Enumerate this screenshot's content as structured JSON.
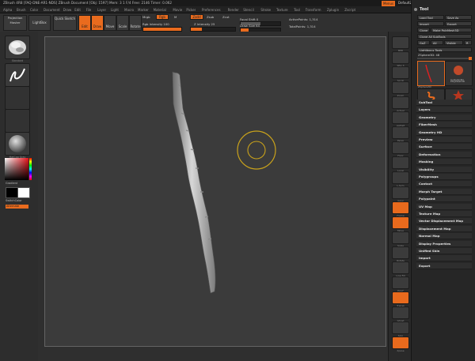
{
  "title_bar": {
    "text": "ZBrush 4R8 [FAQ-DNE-AR1-NDS] ZBrush Document [Obj: 1597] Mem: 3 1 F/4 Free: 2146 Timer: 0.062",
    "menu_label": "Menus",
    "default_script": "DefaultZScript"
  },
  "menu": [
    "Alpha",
    "Brush",
    "Color",
    "Document",
    "Draw",
    "Edit",
    "File",
    "Layer",
    "Light",
    "Macro",
    "Marker",
    "Material",
    "Movie",
    "Picker",
    "Preferences",
    "Render",
    "Stencil",
    "Stroke",
    "Texture",
    "Tool",
    "Transform",
    "Zplugin",
    "Zscript"
  ],
  "shelf": {
    "projection_master": "Projection Master",
    "lightbox": "LightBox",
    "quick_sketch": "Quick Sketch",
    "edit": "Edit",
    "draw": "Draw",
    "move": "Move",
    "scale": "Scale",
    "rotate": "Rotate",
    "mrgb": "Mrgb",
    "rgb": "Rgb",
    "m": "M",
    "zadd": "Zadd",
    "zsub": "Zsub",
    "zcut": "Zcut",
    "rgb_intensity": "Rgb Intensity 100",
    "z_intensity": "Z Intensity 25",
    "focal_shift": "Focal Shift 0",
    "draw_size": "Draw Size 64",
    "active_points": "ActivePoints: 1,314",
    "total_points": "TotalPoints: 1,314"
  },
  "left_shelf": {
    "items": [
      "Standard",
      "FreeHand",
      "Alpha Off",
      "Texture Off",
      "MatCap Gray"
    ],
    "gradient": "Gradient",
    "switch_color": "SwitchColor",
    "alternate": "Alternate"
  },
  "right_shelf": [
    "BPR",
    "SPix 3",
    "Scroll",
    "Zoom",
    "Actual",
    "AAHalf",
    "Persp",
    "Floor",
    "Local",
    "L.Sym",
    "Gxyz",
    "Frame",
    "Move",
    "Scale",
    "Rotate",
    "Line Fill",
    "PolyF",
    "Transp",
    "Ghost",
    "Solo",
    "Xpose"
  ],
  "tool": {
    "title": "Tool",
    "buttons": [
      [
        "Load Tool",
        "Save As"
      ],
      [
        "Import",
        "Export"
      ],
      [
        "Clone",
        "Make PolyMesh3D"
      ],
      [
        "Clone All SubTools"
      ],
      [
        "GoZ",
        "All",
        "Visible",
        "R"
      ]
    ],
    "lightbox_tools": "Lightbox ▸ Tools",
    "zsphere_label": "ZSphere3D: 48",
    "thumbs": [
      "ZSphere3D",
      "Cylinder3D",
      "SimpleBrush",
      "PolyMesh3D"
    ],
    "subpalettes": [
      "SubTool",
      "Layers",
      "Geometry",
      "FiberMesh",
      "Geometry HD",
      "Preview",
      "Surface",
      "Deformation",
      "Masking",
      "Visibility",
      "Polygroups",
      "Contact",
      "Morph Target",
      "Polypaint",
      "UV Map",
      "Texture Map",
      "Vector Displacement Map",
      "Displacement Map",
      "Normal Map",
      "Display Properties",
      "Unified Skin",
      "Import",
      "Export"
    ]
  },
  "colors": {
    "accent": "#e96b1e",
    "canvas": "#3b3b3b",
    "cursor_ring": "#c9a21b"
  }
}
